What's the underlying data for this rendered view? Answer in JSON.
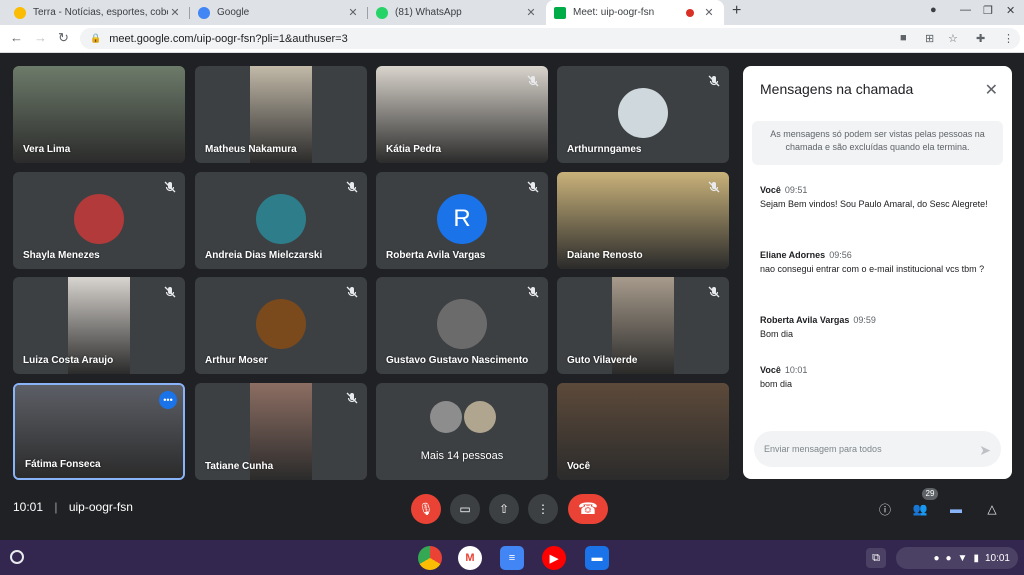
{
  "browser": {
    "tabs": [
      {
        "title": "Terra - Notícias, esportes, cobertu",
        "favicon_color": "#fbbc04"
      },
      {
        "title": "Google",
        "favicon_color": "#4285f4"
      },
      {
        "title": "(81) WhatsApp",
        "favicon_color": "#25d366"
      },
      {
        "title": "Meet: uip-oogr-fsn",
        "favicon_color": "#00ac47"
      }
    ],
    "url": "meet.google.com/uip-oogr-fsn?pli=1&authuser=3"
  },
  "participants": [
    {
      "name": "Vera Lima",
      "muted": false,
      "kind": "video",
      "bg": "#6d7b6a"
    },
    {
      "name": "Matheus Nakamura",
      "muted": false,
      "kind": "video",
      "bg": "#c2b9a8"
    },
    {
      "name": "Kátia Pedra",
      "muted": true,
      "kind": "video",
      "bg": "#d9d4cc"
    },
    {
      "name": "Arthurnngames",
      "muted": true,
      "kind": "avatar",
      "bg": "#cfd8dc"
    },
    {
      "name": "Shayla Menezes",
      "muted": true,
      "kind": "avatar",
      "bg": "#b23a3a"
    },
    {
      "name": "Andreia Dias Mielczarski",
      "muted": true,
      "kind": "avatar",
      "bg": "#2e7d8a"
    },
    {
      "name": "Roberta Avila Vargas",
      "muted": true,
      "kind": "letter",
      "letter": "R"
    },
    {
      "name": "Daiane Renosto",
      "muted": true,
      "kind": "video",
      "bg": "#c9b27a"
    },
    {
      "name": "Luiza Costa Araujo",
      "muted": true,
      "kind": "video",
      "bg": "#d8d4cf"
    },
    {
      "name": "Arthur Moser",
      "muted": true,
      "kind": "avatar",
      "bg": "#7a4a1c"
    },
    {
      "name": "Gustavo Gustavo Nascimento",
      "muted": true,
      "kind": "avatar",
      "bg": "#6b6b6b"
    },
    {
      "name": "Guto Vilaverde",
      "muted": true,
      "kind": "video",
      "bg": "#a79b8c"
    },
    {
      "name": "Fátima Fonseca",
      "muted": false,
      "kind": "video",
      "bg": "#5c5f66"
    },
    {
      "name": "Tatiane Cunha",
      "muted": true,
      "kind": "video",
      "bg": "#8d6e63"
    },
    {
      "name": "Mais 14 pessoas",
      "muted": false,
      "kind": "group"
    },
    {
      "name": "Você",
      "muted": false,
      "kind": "video",
      "bg": "#5d4a3a"
    }
  ],
  "chat": {
    "title": "Mensagens na chamada",
    "notice": "As mensagens só podem ser vistas pelas pessoas na chamada e são excluídas quando ela termina.",
    "messages": [
      {
        "sender": "Você",
        "time": "09:51",
        "text": "Sejam Bem vindos! Sou Paulo Amaral, do Sesc Alegrete!"
      },
      {
        "sender": "Eliane Adornes",
        "time": "09:56",
        "text": "nao consegui entrar com o e-mail institucional vcs tbm ?"
      },
      {
        "sender": "Roberta Avila Vargas",
        "time": "09:59",
        "text": "Bom dia"
      },
      {
        "sender": "Você",
        "time": "10:01",
        "text": "bom dia"
      }
    ],
    "input_placeholder": "Enviar mensagem para todos"
  },
  "meeting": {
    "time": "10:01",
    "separator": "|",
    "code": "uip-oogr-fsn",
    "people_count": "29"
  },
  "shelf": {
    "clock": "10:01",
    "apps": [
      {
        "name": "chrome",
        "color": "#4285f4",
        "glyph": ""
      },
      {
        "name": "gmail",
        "color": "#ffffff",
        "glyph": "M"
      },
      {
        "name": "docs",
        "color": "#4285f4",
        "glyph": "≡"
      },
      {
        "name": "youtube",
        "color": "#ff0000",
        "glyph": "▶"
      },
      {
        "name": "files",
        "color": "#1a73e8",
        "glyph": "▬"
      }
    ]
  },
  "colors": {
    "accent": "#1a73e8",
    "danger": "#ea4335",
    "background": "#202124",
    "tile": "#3c4043"
  }
}
